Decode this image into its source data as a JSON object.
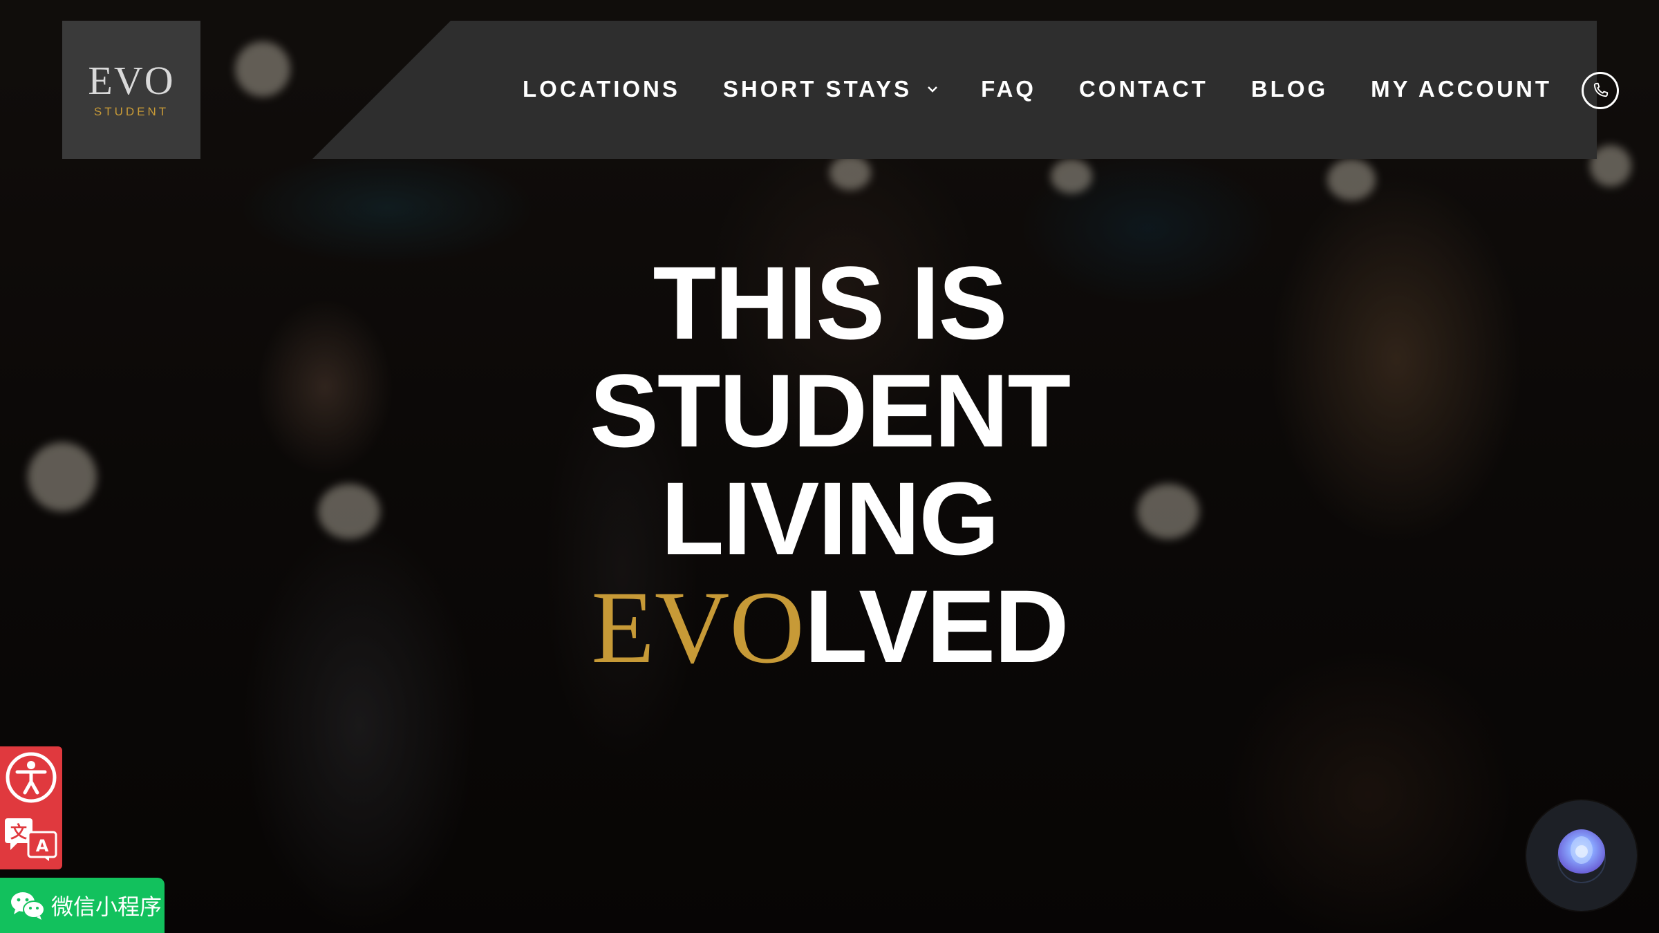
{
  "brand": {
    "logo_main": "EVO",
    "logo_sub": "STUDENT",
    "accent_color": "#c79a37"
  },
  "nav": {
    "items": [
      {
        "label": "LOCATIONS"
      },
      {
        "label": "SHORT STAYS",
        "has_dropdown": true
      },
      {
        "label": "FAQ"
      },
      {
        "label": "CONTACT"
      },
      {
        "label": "BLOG"
      },
      {
        "label": "MY ACCOUNT"
      }
    ],
    "phone_icon": "phone-icon"
  },
  "hero": {
    "line1": "THIS IS",
    "line2": "STUDENT",
    "line3": "LIVING",
    "line4_accent": "EVO",
    "line4_rest": "LVED"
  },
  "widgets": {
    "accessibility_icon": "accessibility-icon",
    "translate_icon": "translate-icon",
    "wechat_label": "微信小程序",
    "wechat_color": "#12c15d",
    "a11y_color": "#e0393e",
    "chat_icon": "chat-assistant-icon"
  }
}
